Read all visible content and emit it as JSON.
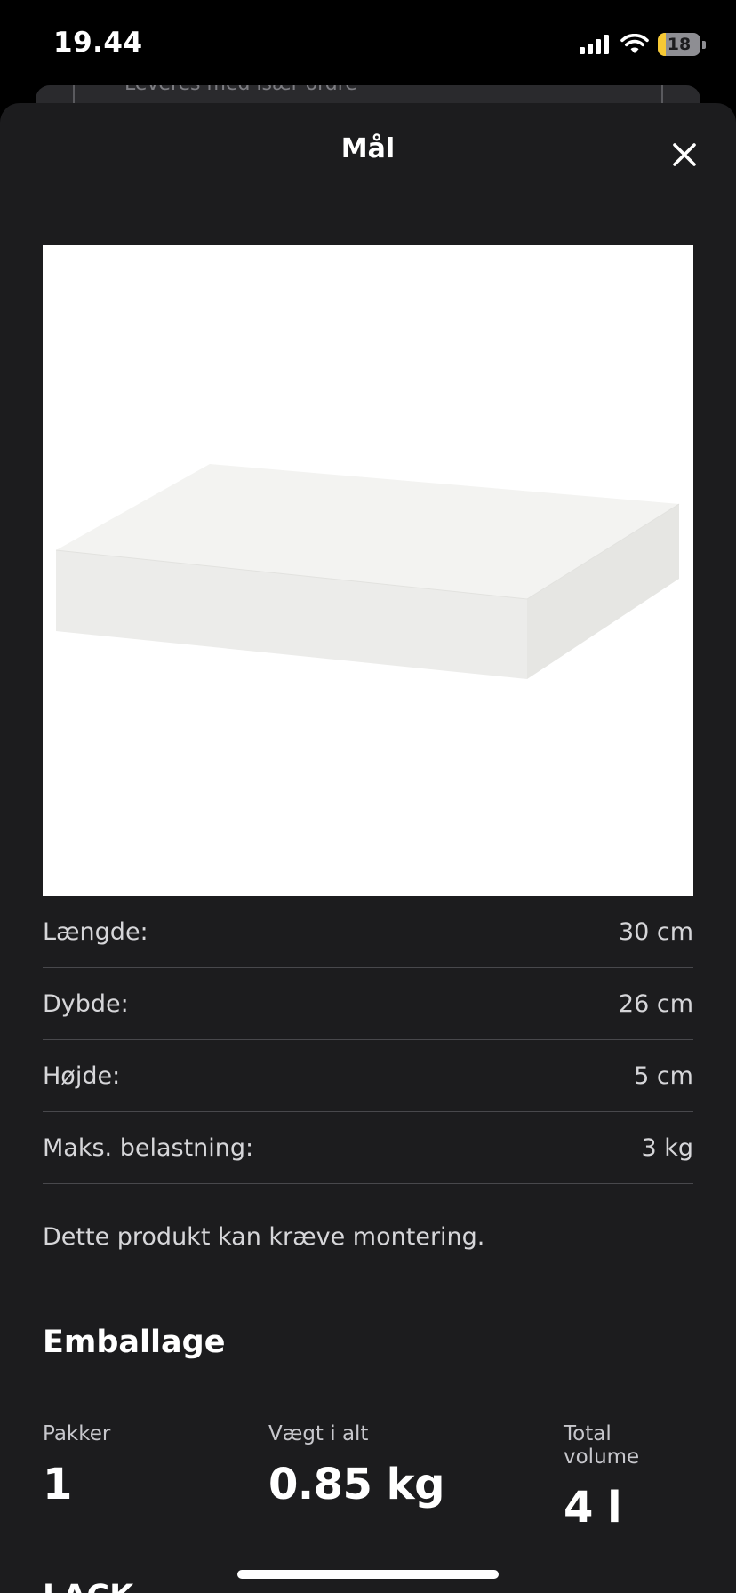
{
  "status_bar": {
    "time": "19.44",
    "battery": "18"
  },
  "background_sheet": {
    "peek_text": "Leveres med især ordre"
  },
  "sheet": {
    "title": "Mål",
    "close_icon": "close-icon"
  },
  "product": {
    "image_alt": "LACK shelf product image"
  },
  "dimensions": [
    {
      "label": "Længde:",
      "value": "30 cm"
    },
    {
      "label": "Dybde:",
      "value": "26 cm"
    },
    {
      "label": "Højde:",
      "value": "5 cm"
    },
    {
      "label": "Maks. belastning:",
      "value": "3 kg"
    }
  ],
  "note": "Dette produkt kan kræve montering.",
  "packaging": {
    "heading": "Emballage",
    "stats": [
      {
        "label": "Pakker",
        "value": "1"
      },
      {
        "label": "Vægt i alt",
        "value": "0.85 kg"
      },
      {
        "label": "Total volume",
        "value": "4 l"
      }
    ]
  },
  "next_section": {
    "heading": "LACK"
  },
  "colors": {
    "sheet_bg": "#1c1c1e",
    "divider": "#48484c",
    "battery_accent": "#f7c934"
  }
}
